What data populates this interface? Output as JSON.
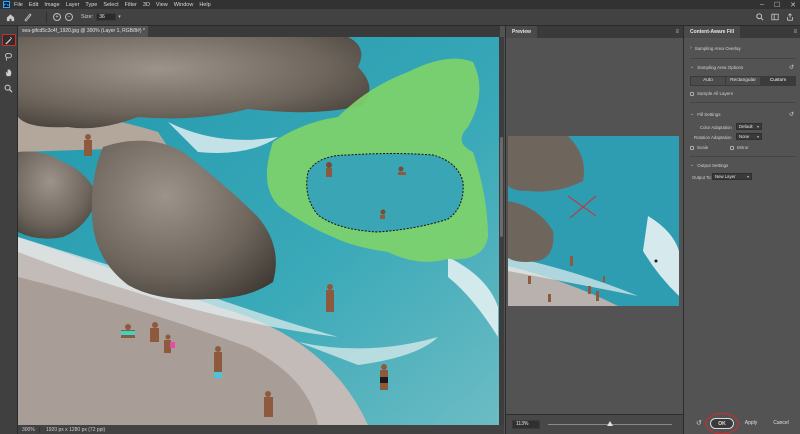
{
  "menubar": {
    "logo": "Ps",
    "items": [
      "File",
      "Edit",
      "Image",
      "Layer",
      "Type",
      "Select",
      "Filter",
      "3D",
      "View",
      "Window",
      "Help"
    ],
    "window_controls": [
      "–",
      "☐",
      "✕"
    ]
  },
  "options": {
    "size_label": "Size:",
    "size_value": "36"
  },
  "document": {
    "tab_title": "sea-gifcd5c3c4f_1920.jpg @ 300% (Layer 1, RGB/8#) *",
    "tab_close": "×",
    "zoom": "300%",
    "info": "1920 px x 1280 px (72 ppi)"
  },
  "preview": {
    "title": "Preview",
    "menu": "≡",
    "zoom_value": "113%",
    "zoom_level_percent": 50
  },
  "caf": {
    "title": "Content-Aware Fill",
    "menu": "≡",
    "sampling_overlay": "Sampling Area Overlay",
    "sampling_options": "Sampling Area Options",
    "segments": [
      "Auto",
      "Rectangular",
      "Custom"
    ],
    "active_segment": "Custom",
    "sample_all_layers": "Sample All Layers",
    "fill_settings": "Fill Settings",
    "color_adaptation_label": "Color Adaptation",
    "color_adaptation_value": "Default",
    "rotation_adaptation_label": "Rotation Adaptation",
    "rotation_adaptation_value": "None",
    "scale_label": "Scale",
    "mirror_label": "Mirror",
    "output_settings": "Output Settings",
    "output_to_label": "Output To:",
    "output_to_value": "New Layer",
    "ok": "OK",
    "apply": "Apply",
    "cancel": "Cancel"
  },
  "colors": {
    "highlight": "#d42b2b",
    "overlay_green": "#7ed36a",
    "water": "#38a3b5"
  }
}
